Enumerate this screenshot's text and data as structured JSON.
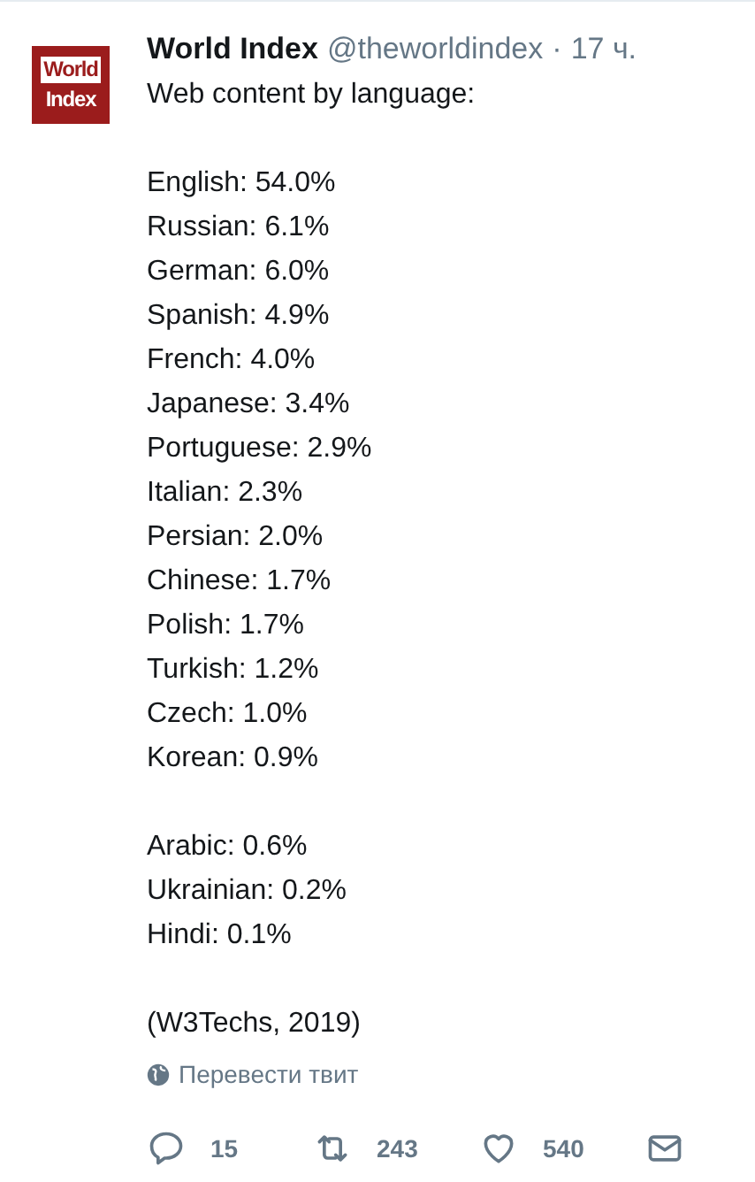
{
  "avatar": {
    "lines": [
      "World",
      "Index"
    ]
  },
  "author": {
    "name": "World Index",
    "handle": "@theworldindex",
    "separator": "·",
    "time": "17 ч."
  },
  "paragraphs": [
    [
      "Web content by language:"
    ],
    [
      "English: 54.0%",
      "Russian: 6.1%",
      "German: 6.0%",
      "Spanish: 4.9%",
      "French: 4.0%",
      "Japanese: 3.4%",
      "Portuguese: 2.9%",
      "Italian: 2.3%",
      "Persian: 2.0%",
      "Chinese: 1.7%",
      "Polish: 1.7%",
      "Turkish: 1.2%",
      "Czech: 1.0%",
      "Korean: 0.9%"
    ],
    [
      "Arabic: 0.6%",
      "Ukrainian: 0.2%",
      "Hindi: 0.1%"
    ],
    [
      "(W3Techs, 2019)"
    ]
  ],
  "translate": "Перевести твит",
  "actions": [
    {
      "kind": "reply",
      "count": "15"
    },
    {
      "kind": "retweet",
      "count": "243"
    },
    {
      "kind": "like",
      "count": "540"
    },
    {
      "kind": "message"
    }
  ]
}
